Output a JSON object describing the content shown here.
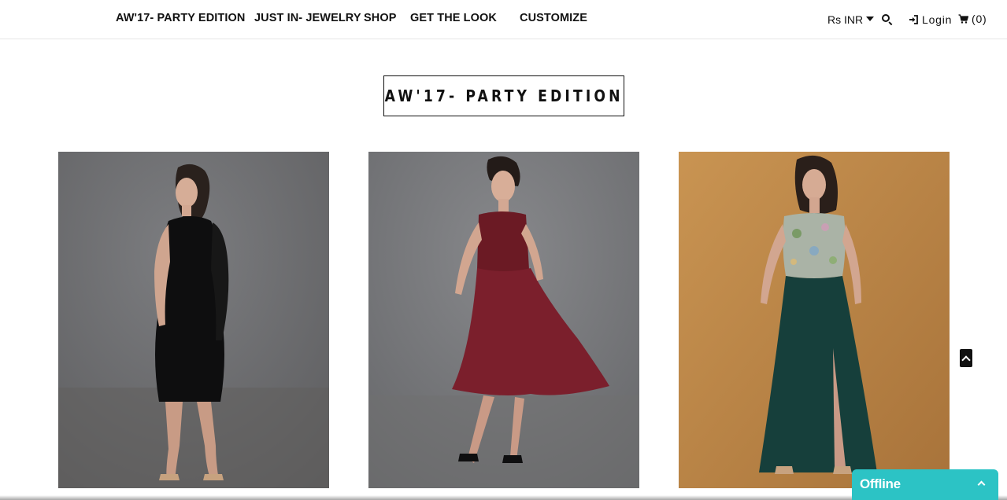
{
  "nav": {
    "items": [
      {
        "label": "AW'17- PARTY EDITION"
      },
      {
        "label": "JUST IN- JEWELRY"
      },
      {
        "label": "SHOP"
      },
      {
        "label": "GET THE LOOK"
      },
      {
        "label": "CUSTOMIZE"
      }
    ]
  },
  "header_right": {
    "currency": "Rs INR",
    "login": "Login",
    "cart": "(0)"
  },
  "page": {
    "heading": "AW'17- PARTY EDITION"
  },
  "products": [
    {
      "dress": "black one-shoulder sheath dress"
    },
    {
      "dress": "maroon fit and flare dress"
    },
    {
      "dress": "teal maxi skirt with embroidered top"
    }
  ],
  "chat_widget": {
    "status": "Offline"
  },
  "colors": {
    "chat_teal": "#2cc3c5",
    "text": "#111111",
    "photo_gray": "#6f7072",
    "photo_tan": "#c08a4a"
  }
}
